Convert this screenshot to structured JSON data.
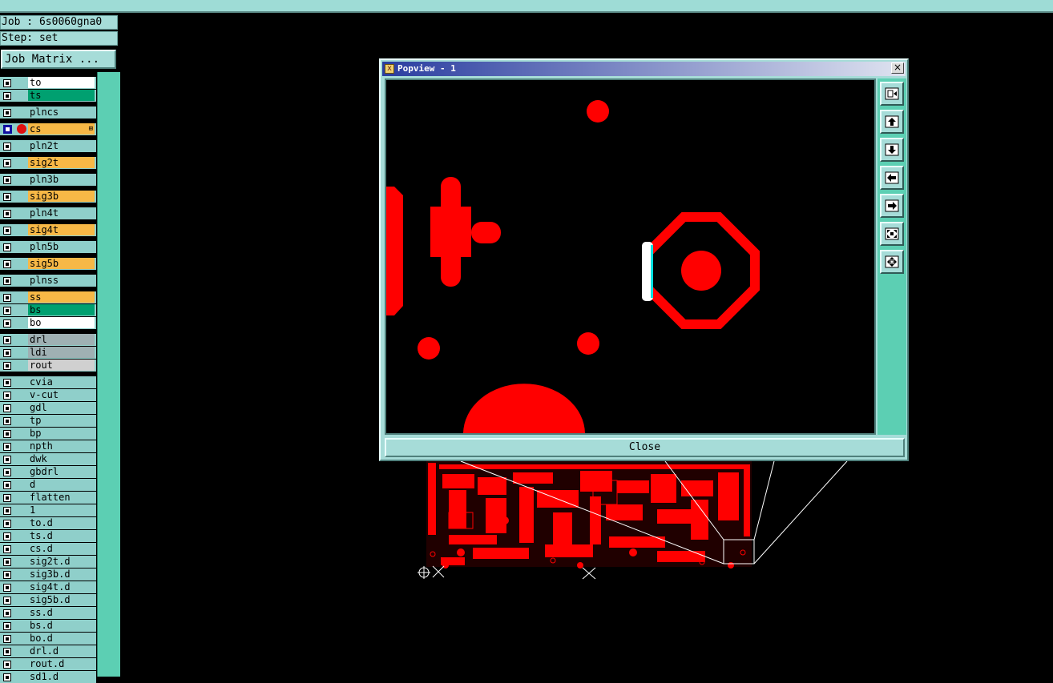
{
  "job": {
    "label": "Job : 6s0060gna0",
    "step": "Step: set",
    "job_matrix_button": "Job Matrix ..."
  },
  "colors": {
    "panel_bg": "#a6dcd8",
    "accent_green": "#00a070",
    "yellow": "#f7b846",
    "copper": "#ff0000"
  },
  "layers": [
    {
      "name": "to",
      "color": "#ffffff"
    },
    {
      "name": "ts",
      "color": "#00a070"
    },
    {
      "name": "plncs",
      "color": "#8fcfca"
    },
    {
      "name": "cs",
      "color": "#f7b846",
      "active": true
    },
    {
      "name": "pln2t",
      "color": "#8fcfca"
    },
    {
      "name": "sig2t",
      "color": "#f7b846"
    },
    {
      "name": "pln3b",
      "color": "#8fcfca"
    },
    {
      "name": "sig3b",
      "color": "#f7b846"
    },
    {
      "name": "pln4t",
      "color": "#8fcfca"
    },
    {
      "name": "sig4t",
      "color": "#f7b846"
    },
    {
      "name": "pln5b",
      "color": "#8fcfca"
    },
    {
      "name": "sig5b",
      "color": "#f7b846"
    },
    {
      "name": "plnss",
      "color": "#8fcfca"
    },
    {
      "name": "ss",
      "color": "#f7b846"
    },
    {
      "name": "bs",
      "color": "#00a070"
    },
    {
      "name": "bo",
      "color": "#ffffff"
    },
    {
      "name": "drl",
      "color": "#9fb0b3"
    },
    {
      "name": "ldi",
      "color": "#9fb0b3"
    },
    {
      "name": "rout",
      "color": "#d0d0d0"
    },
    {
      "name": "cvia",
      "color": "#8fcfca"
    },
    {
      "name": "v-cut",
      "color": "#8fcfca"
    },
    {
      "name": "gdl",
      "color": "#8fcfca"
    },
    {
      "name": "tp",
      "color": "#8fcfca"
    },
    {
      "name": "bp",
      "color": "#8fcfca"
    },
    {
      "name": "npth",
      "color": "#8fcfca"
    },
    {
      "name": "dwk",
      "color": "#8fcfca"
    },
    {
      "name": "gbdrl",
      "color": "#8fcfca"
    },
    {
      "name": "d",
      "color": "#8fcfca"
    },
    {
      "name": "flatten",
      "color": "#8fcfca"
    },
    {
      "name": "1",
      "color": "#8fcfca"
    },
    {
      "name": "to.d",
      "color": "#8fcfca"
    },
    {
      "name": "ts.d",
      "color": "#8fcfca"
    },
    {
      "name": "cs.d",
      "color": "#8fcfca"
    },
    {
      "name": "sig2t.d",
      "color": "#8fcfca"
    },
    {
      "name": "sig3b.d",
      "color": "#8fcfca"
    },
    {
      "name": "sig4t.d",
      "color": "#8fcfca"
    },
    {
      "name": "sig5b.d",
      "color": "#8fcfca"
    },
    {
      "name": "ss.d",
      "color": "#8fcfca"
    },
    {
      "name": "bs.d",
      "color": "#8fcfca"
    },
    {
      "name": "bo.d",
      "color": "#8fcfca"
    },
    {
      "name": "drl.d",
      "color": "#8fcfca"
    },
    {
      "name": "rout.d",
      "color": "#8fcfca"
    },
    {
      "name": "sd1.d",
      "color": "#8fcfca"
    }
  ],
  "popview": {
    "title": "Popview - 1",
    "close_x": "×",
    "close_button": "Close",
    "tools": [
      "zoom-home-icon",
      "pan-up-icon",
      "pan-down-icon",
      "pan-left-icon",
      "pan-right-icon",
      "zoom-fit-icon",
      "zoom-center-icon"
    ]
  }
}
